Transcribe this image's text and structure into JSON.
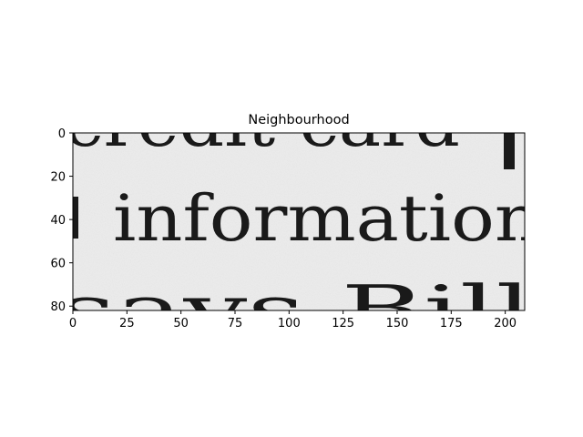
{
  "figure": {
    "title": "Neighbourhood",
    "image_text_lines": [
      "credit-card",
      "information",
      "says  Bill"
    ],
    "x_ticks": [
      "0",
      "25",
      "50",
      "75",
      "100",
      "125",
      "150",
      "175",
      "200"
    ],
    "y_ticks": [
      "0",
      "20",
      "40",
      "60",
      "80"
    ],
    "xlim": [
      0,
      209
    ],
    "ylim": [
      82,
      0
    ],
    "colors": {
      "paper": "#ececec",
      "ink": "#1a1a1a",
      "axes": "#000000"
    }
  }
}
